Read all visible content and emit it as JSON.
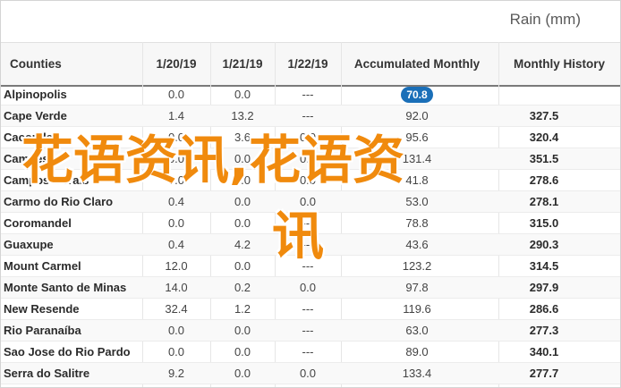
{
  "title": "Rain (mm)",
  "columns": [
    "Counties",
    "1/20/19",
    "1/21/19",
    "1/22/19",
    "Accumulated Monthly",
    "Monthly History"
  ],
  "rows": [
    {
      "county": "Alpinopolis",
      "d1": "0.0",
      "d2": "0.0",
      "d3": "---",
      "acc": "70.8",
      "hist": "",
      "highlight": true
    },
    {
      "county": "Cape Verde",
      "d1": "1.4",
      "d2": "13.2",
      "d3": "---",
      "acc": "92.0",
      "hist": "327.5"
    },
    {
      "county": "Caconde",
      "d1": "0.0",
      "d2": "3.6",
      "d3": "0.0",
      "acc": "95.6",
      "hist": "320.4"
    },
    {
      "county": "Campestre",
      "d1": "0.0",
      "d2": "0.0",
      "d3": "0.0",
      "acc": "131.4",
      "hist": "351.5"
    },
    {
      "county": "Campos Gerais",
      "d1": "0.0",
      "d2": "0.0",
      "d3": "0.0",
      "acc": "41.8",
      "hist": "278.6"
    },
    {
      "county": "Carmo do Rio Claro",
      "d1": "0.4",
      "d2": "0.0",
      "d3": "0.0",
      "acc": "53.0",
      "hist": "278.1"
    },
    {
      "county": "Coromandel",
      "d1": "0.0",
      "d2": "0.0",
      "d3": "---",
      "acc": "78.8",
      "hist": "315.0"
    },
    {
      "county": "Guaxupe",
      "d1": "0.4",
      "d2": "4.2",
      "d3": "---",
      "acc": "43.6",
      "hist": "290.3"
    },
    {
      "county": "Mount Carmel",
      "d1": "12.0",
      "d2": "0.0",
      "d3": "---",
      "acc": "123.2",
      "hist": "314.5"
    },
    {
      "county": "Monte Santo de Minas",
      "d1": "14.0",
      "d2": "0.2",
      "d3": "0.0",
      "acc": "97.8",
      "hist": "297.9"
    },
    {
      "county": "New Resende",
      "d1": "32.4",
      "d2": "1.2",
      "d3": "---",
      "acc": "119.6",
      "hist": "286.6"
    },
    {
      "county": "Rio Paranaíba",
      "d1": "0.0",
      "d2": "0.0",
      "d3": "---",
      "acc": "63.0",
      "hist": "277.3"
    },
    {
      "county": "Sao Jose do Rio Pardo",
      "d1": "0.0",
      "d2": "0.0",
      "d3": "---",
      "acc": "89.0",
      "hist": "340.1"
    },
    {
      "county": "Serra do Salitre",
      "d1": "9.2",
      "d2": "0.0",
      "d3": "0.0",
      "acc": "133.4",
      "hist": "277.7"
    }
  ],
  "watermark": {
    "line1": "花语资讯,花语资",
    "line2": "讯"
  },
  "colors": {
    "accent": "#1a6fb8",
    "watermark": "#f08a0d",
    "header_border": "#7a7a7a"
  }
}
